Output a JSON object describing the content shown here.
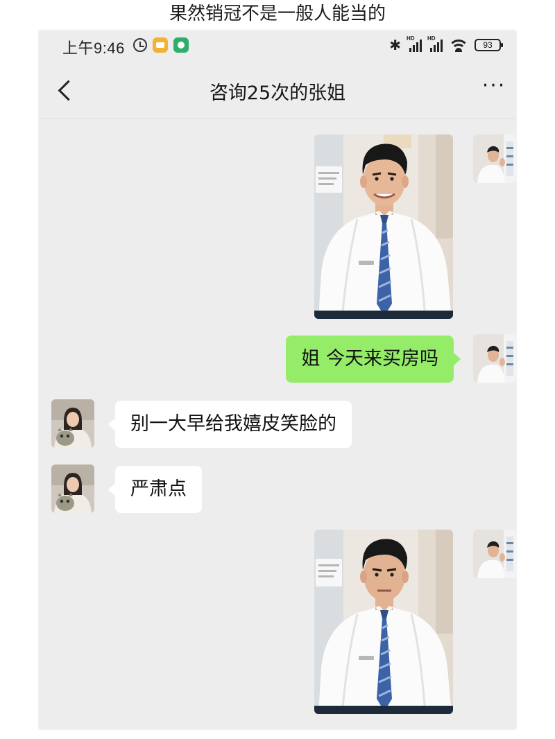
{
  "caption": "果然销冠不是一般人能当的",
  "status_bar": {
    "time": "上午9:46",
    "signal_label_1": "HD",
    "signal_label_2": "HD",
    "battery": "93"
  },
  "nav": {
    "title": "咨询25次的张姐",
    "more": "···"
  },
  "messages": [
    {
      "from": "self",
      "kind": "image",
      "content": "man-smiling-photo"
    },
    {
      "from": "self",
      "kind": "text",
      "content": "姐 今天来买房吗"
    },
    {
      "from": "other",
      "kind": "text",
      "content": "别一大早给我嬉皮笑脸的"
    },
    {
      "from": "other",
      "kind": "text",
      "content": "严肃点"
    },
    {
      "from": "self",
      "kind": "image",
      "content": "man-serious-photo"
    }
  ],
  "colors": {
    "chat_background": "#ededed",
    "self_bubble": "#95ec69",
    "other_bubble": "#ffffff"
  }
}
